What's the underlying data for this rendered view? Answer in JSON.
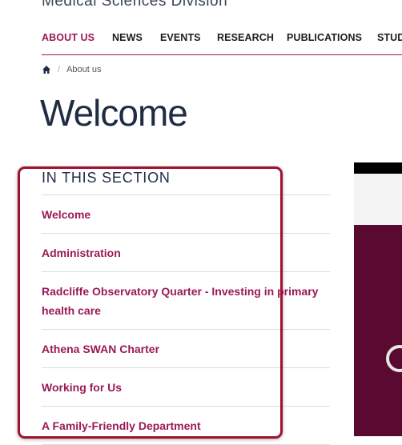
{
  "header": {
    "site_title": "Medical Sciences Division"
  },
  "nav": {
    "items": [
      {
        "label": "ABOUT US",
        "active": true
      },
      {
        "label": "NEWS"
      },
      {
        "label": "EVENTS"
      },
      {
        "label": "RESEARCH"
      },
      {
        "label": "PUBLICATIONS"
      },
      {
        "label": "STUD"
      }
    ]
  },
  "breadcrumb": {
    "home_icon": "home-icon",
    "separator": "/",
    "current": "About us"
  },
  "page": {
    "title": "Welcome"
  },
  "section_nav": {
    "heading": "IN THIS SECTION",
    "items": [
      {
        "label": "Welcome"
      },
      {
        "label": "Administration"
      },
      {
        "label": "Radcliffe Observatory Quarter - Investing in primary health care"
      },
      {
        "label": "Athena SWAN Charter"
      },
      {
        "label": "Working for Us"
      },
      {
        "label": "A Family-Friendly Department"
      }
    ]
  },
  "colors": {
    "accent": "#9a1a55",
    "highlight_box": "#a2112d",
    "title_text": "#1f2c44"
  }
}
